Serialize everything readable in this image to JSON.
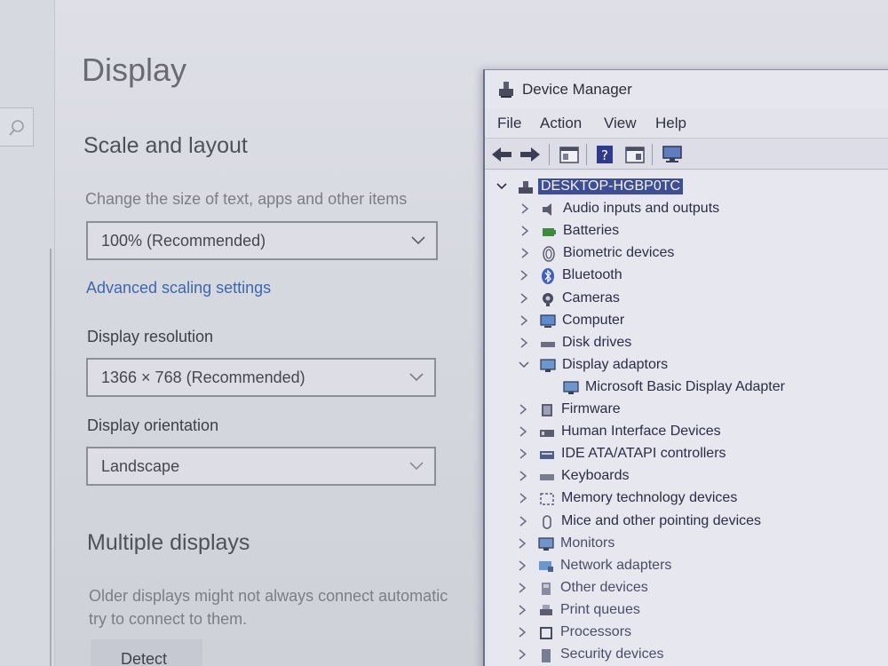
{
  "settings": {
    "page_title": "Display",
    "scale_section_title": "Scale and layout",
    "scale_label": "Change the size of text, apps and other items",
    "scale_value": "100% (Recommended)",
    "advanced_link": "Advanced scaling settings",
    "resolution_label": "Display resolution",
    "resolution_value": "1366 × 768 (Recommended)",
    "orientation_label": "Display orientation",
    "orientation_value": "Landscape",
    "multiple_title": "Multiple displays",
    "multiple_desc_1": "Older displays might not always connect automatic",
    "multiple_desc_2": "try to connect to them.",
    "detect_label": "Detect"
  },
  "device_manager": {
    "title": "Device Manager",
    "menu": [
      "File",
      "Action",
      "View",
      "Help"
    ],
    "toolbar_icons": [
      "back-arrow-icon",
      "forward-arrow-icon",
      "properties-icon",
      "help-icon",
      "show-hidden-icon",
      "scan-hardware-icon"
    ],
    "root": "DESKTOP-HGBP0TC",
    "categories": [
      {
        "label": "Audio inputs and outputs",
        "icon": "speaker-icon",
        "expanded": false
      },
      {
        "label": "Batteries",
        "icon": "battery-icon",
        "expanded": false
      },
      {
        "label": "Biometric devices",
        "icon": "fingerprint-icon",
        "expanded": false
      },
      {
        "label": "Bluetooth",
        "icon": "bluetooth-icon",
        "expanded": false
      },
      {
        "label": "Cameras",
        "icon": "camera-icon",
        "expanded": false
      },
      {
        "label": "Computer",
        "icon": "computer-icon",
        "expanded": false
      },
      {
        "label": "Disk drives",
        "icon": "disk-drive-icon",
        "expanded": false
      },
      {
        "label": "Display adaptors",
        "icon": "monitor-icon",
        "expanded": true,
        "children": [
          "Microsoft Basic Display Adapter"
        ]
      },
      {
        "label": "Firmware",
        "icon": "firmware-icon",
        "expanded": false
      },
      {
        "label": "Human Interface Devices",
        "icon": "hid-icon",
        "expanded": false
      },
      {
        "label": "IDE ATA/ATAPI controllers",
        "icon": "ide-controller-icon",
        "expanded": false
      },
      {
        "label": "Keyboards",
        "icon": "keyboard-icon",
        "expanded": false
      },
      {
        "label": "Memory technology devices",
        "icon": "memory-icon",
        "expanded": false
      },
      {
        "label": "Mice and other pointing devices",
        "icon": "mouse-icon",
        "expanded": false
      },
      {
        "label": "Monitors",
        "icon": "monitor-icon",
        "expanded": false
      },
      {
        "label": "Network adapters",
        "icon": "network-adapter-icon",
        "expanded": false
      },
      {
        "label": "Other devices",
        "icon": "other-devices-icon",
        "expanded": false
      },
      {
        "label": "Print queues",
        "icon": "printer-icon",
        "expanded": false
      },
      {
        "label": "Processors",
        "icon": "processor-icon",
        "expanded": false
      },
      {
        "label": "Security devices",
        "icon": "security-device-icon",
        "expanded": false
      }
    ]
  },
  "colors": {
    "root_highlight": "#3f4e94",
    "link": "#3f67a8"
  }
}
